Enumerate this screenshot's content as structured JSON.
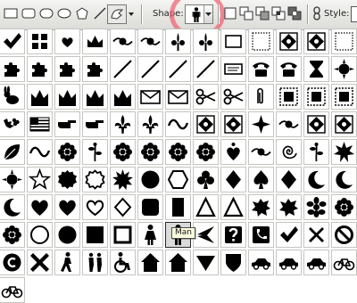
{
  "toolbar": {
    "tools": [
      {
        "name": "rectangle-tool-icon",
        "glyph": "rect"
      },
      {
        "name": "rounded-rectangle-tool-icon",
        "glyph": "rrect"
      },
      {
        "name": "ellipse-tool-icon",
        "glyph": "ellipse"
      },
      {
        "name": "polygon-tool-icon",
        "glyph": "polygon"
      },
      {
        "name": "line-tool-icon",
        "glyph": "line"
      },
      {
        "name": "custom-shape-tool-icon",
        "glyph": "custom"
      }
    ],
    "shape_label": "Shape:",
    "selected_shape_icon": "man-icon",
    "path_ops": [
      "add-to-shape-area-icon",
      "subtract-from-shape-area-icon",
      "intersect-shape-areas-icon",
      "exclude-overlapping-areas-icon"
    ],
    "link_icon": "link-layer-style-icon",
    "style_label": "Style:",
    "highlight_color": "#f06070"
  },
  "shape_library": {
    "columns": 13,
    "shapes": [
      "checkmark-icon",
      "grid-icon",
      "heart-swirl-icon",
      "crown-flourish-icon",
      "ornament-icon",
      "ornament-icon",
      "fleur-icon",
      "fleur-icon",
      "sign-icon",
      "frame-icon",
      "tile-icon",
      "tile-icon",
      "frame-icon",
      "puzzle-piece-icon",
      "puzzle-piece-icon",
      "puzzle-piece-icon",
      "puzzle-piece-icon",
      "slash-icon",
      "slash-icon",
      "slash-icon",
      "slash-icon",
      "scroll-banner-icon",
      "telephone-icon",
      "telephone-icon",
      "hourglass-icon",
      "sun-burst-icon",
      "rabbit-icon",
      "crown-icon",
      "crown-icon",
      "crown-icon",
      "crown-icon",
      "envelope-icon",
      "envelope-icon",
      "scissors-icon",
      "scissors-icon",
      "paperclip-icon",
      "stamp-icon",
      "stamp-icon",
      "stamp-icon",
      "holly-icon",
      "flag-icon",
      "pointing-hand-icon",
      "pointing-hand-icon",
      "fleur-de-lis-icon",
      "fleur-de-lis-icon",
      "wave-ornament-icon",
      "tile-icon",
      "tile-icon",
      "diamond-flower-icon",
      "ornament-icon",
      "tile-icon",
      "tile-icon",
      "leaf-icon",
      "wave-ornament-icon",
      "flower-icon",
      "vine-icon",
      "flower-icon",
      "flower-icon",
      "flower-icon",
      "flower-icon",
      "heart-ornament-icon",
      "ornament-icon",
      "spiral-icon",
      "vine-icon",
      "star-burst-icon",
      "sun-burst-icon",
      "star-outline-icon",
      "seal-icon",
      "seal-outline-icon",
      "starburst-icon",
      "circle-icon",
      "hexagon-icon",
      "club-icon",
      "diamond-icon",
      "spade-icon",
      "diamond-icon",
      "moon-icon",
      "moon-icon",
      "moon-icon",
      "heart-icon",
      "heart-icon",
      "heart-outline-icon",
      "diamond-outline-icon",
      "rounded-square-icon",
      "rectangle-icon",
      "triangle-icon",
      "triangle-icon",
      "splat-icon",
      "splat-icon",
      "snowflake-icon",
      "flower-icon",
      "flower-icon",
      "circle-outline-icon",
      "circle-icon",
      "square-icon",
      "square-outline-icon",
      "woman-icon",
      "man-icon",
      "airplane-icon",
      "question-icon",
      "telephone-box-icon",
      "checkmark-icon",
      "x-icon",
      "no-symbol-icon",
      "copyright-icon",
      "x-bold-icon",
      "walker-icon",
      "pedestrians-icon",
      "wheelchair-icon",
      "house-icon",
      "house-icon",
      "arrow-down-icon",
      "shield-icon",
      "car-icon",
      "car-icon",
      "car-icon",
      "bicycle-icon",
      "bicycle-icon"
    ]
  },
  "tooltip": {
    "text": "Man"
  }
}
